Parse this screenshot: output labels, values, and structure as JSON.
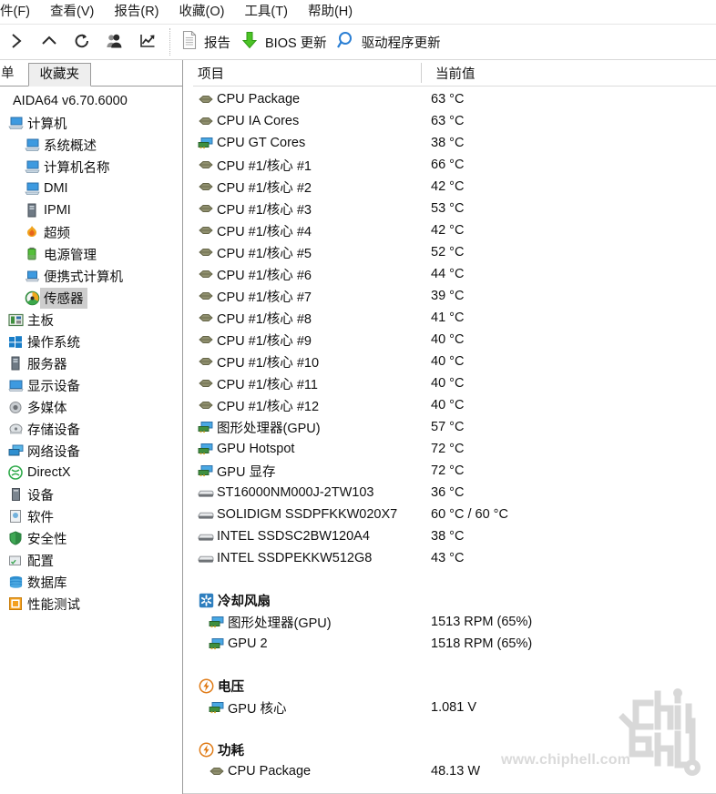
{
  "menu": {
    "items": [
      {
        "label": "件(F)",
        "name": "menu-file"
      },
      {
        "label": "查看(V)",
        "name": "menu-view"
      },
      {
        "label": "报告(R)",
        "name": "menu-report"
      },
      {
        "label": "收藏(O)",
        "name": "menu-favorites"
      },
      {
        "label": "工具(T)",
        "name": "menu-tools"
      },
      {
        "label": "帮助(H)",
        "name": "menu-help"
      }
    ]
  },
  "toolbar": {
    "icons": [
      {
        "name": "forward-icon"
      },
      {
        "name": "up-icon"
      },
      {
        "name": "refresh-icon"
      },
      {
        "name": "users-icon"
      },
      {
        "name": "chart-icon"
      }
    ],
    "report_label": "报告",
    "bios_update_label": "BIOS 更新",
    "driver_update_label": "驱动程序更新"
  },
  "tabs": {
    "menu_tab": "单",
    "favorites_tab": "收藏夹"
  },
  "tree": {
    "root": "AIDA64 v6.70.6000",
    "items": [
      {
        "label": "计算机",
        "icon": "computer-icon",
        "level": 1
      },
      {
        "label": "系统概述",
        "icon": "computer-icon",
        "level": 2
      },
      {
        "label": "计算机名称",
        "icon": "computer-icon",
        "level": 2
      },
      {
        "label": "DMI",
        "icon": "computer-icon",
        "level": 2
      },
      {
        "label": "IPMI",
        "icon": "server-icon",
        "level": 2
      },
      {
        "label": "超频",
        "icon": "flame-icon",
        "level": 2
      },
      {
        "label": "电源管理",
        "icon": "battery-icon",
        "level": 2
      },
      {
        "label": "便携式计算机",
        "icon": "laptop-icon",
        "level": 2
      },
      {
        "label": "传感器",
        "icon": "sensor-icon",
        "level": 2,
        "selected": true
      },
      {
        "label": "主板",
        "icon": "motherboard-icon",
        "level": 1
      },
      {
        "label": "操作系统",
        "icon": "windows-icon",
        "level": 1
      },
      {
        "label": "服务器",
        "icon": "server-icon",
        "level": 1
      },
      {
        "label": "显示设备",
        "icon": "display-icon",
        "level": 1
      },
      {
        "label": "多媒体",
        "icon": "speaker-icon",
        "level": 1
      },
      {
        "label": "存储设备",
        "icon": "storage-icon",
        "level": 1
      },
      {
        "label": "网络设备",
        "icon": "network-icon",
        "level": 1
      },
      {
        "label": "DirectX",
        "icon": "directx-icon",
        "level": 1
      },
      {
        "label": "设备",
        "icon": "device-icon",
        "level": 1
      },
      {
        "label": "软件",
        "icon": "software-icon",
        "level": 1
      },
      {
        "label": "安全性",
        "icon": "shield-icon",
        "level": 1
      },
      {
        "label": "配置",
        "icon": "config-icon",
        "level": 1
      },
      {
        "label": "数据库",
        "icon": "database-icon",
        "level": 1
      },
      {
        "label": "性能测试",
        "icon": "benchmark-icon",
        "level": 1
      }
    ]
  },
  "columns": {
    "item": "项目",
    "current_value": "当前值"
  },
  "sensors": {
    "temperatures": [
      {
        "label": "CPU Package",
        "value": "63 °C",
        "icon": "chip-icon"
      },
      {
        "label": "CPU IA Cores",
        "value": "63 °C",
        "icon": "chip-icon"
      },
      {
        "label": "CPU GT Cores",
        "value": "38 °C",
        "icon": "gpu-icon"
      },
      {
        "label": "CPU #1/核心 #1",
        "value": "66 °C",
        "icon": "chip-icon"
      },
      {
        "label": "CPU #1/核心 #2",
        "value": "42 °C",
        "icon": "chip-icon"
      },
      {
        "label": "CPU #1/核心 #3",
        "value": "53 °C",
        "icon": "chip-icon"
      },
      {
        "label": "CPU #1/核心 #4",
        "value": "42 °C",
        "icon": "chip-icon"
      },
      {
        "label": "CPU #1/核心 #5",
        "value": "52 °C",
        "icon": "chip-icon"
      },
      {
        "label": "CPU #1/核心 #6",
        "value": "44 °C",
        "icon": "chip-icon"
      },
      {
        "label": "CPU #1/核心 #7",
        "value": "39 °C",
        "icon": "chip-icon"
      },
      {
        "label": "CPU #1/核心 #8",
        "value": "41 °C",
        "icon": "chip-icon"
      },
      {
        "label": "CPU #1/核心 #9",
        "value": "40 °C",
        "icon": "chip-icon"
      },
      {
        "label": "CPU #1/核心 #10",
        "value": "40 °C",
        "icon": "chip-icon"
      },
      {
        "label": "CPU #1/核心 #11",
        "value": "40 °C",
        "icon": "chip-icon"
      },
      {
        "label": "CPU #1/核心 #12",
        "value": "40 °C",
        "icon": "chip-icon"
      },
      {
        "label": "图形处理器(GPU)",
        "value": "57 °C",
        "icon": "gpu-icon"
      },
      {
        "label": "GPU Hotspot",
        "value": "72 °C",
        "icon": "gpu-icon"
      },
      {
        "label": "GPU 显存",
        "value": "72 °C",
        "icon": "gpu-icon"
      },
      {
        "label": "ST16000NM000J-2TW103",
        "value": "36 °C",
        "icon": "hdd-icon"
      },
      {
        "label": "SOLIDIGM SSDPFKKW020X7",
        "value": "60 °C / 60 °C",
        "icon": "hdd-icon"
      },
      {
        "label": "INTEL SSDSC2BW120A4",
        "value": "38 °C",
        "icon": "hdd-icon"
      },
      {
        "label": "INTEL SSDPEKKW512G8",
        "value": "43 °C",
        "icon": "hdd-icon"
      }
    ],
    "fans": {
      "title": "冷却风扇",
      "icon": "fan-icon",
      "rows": [
        {
          "label": "图形处理器(GPU)",
          "value": "1513 RPM  (65%)",
          "icon": "gpu-icon"
        },
        {
          "label": "GPU 2",
          "value": "1518 RPM  (65%)",
          "icon": "gpu-icon"
        }
      ]
    },
    "voltages": {
      "title": "电压",
      "icon": "bolt-icon",
      "rows": [
        {
          "label": "GPU 核心",
          "value": "1.081 V",
          "icon": "gpu-icon"
        }
      ]
    },
    "power": {
      "title": "功耗",
      "icon": "bolt-icon",
      "rows": [
        {
          "label": "CPU Package",
          "value": "48.13 W",
          "icon": "chip-icon"
        }
      ]
    }
  },
  "watermark": {
    "url_text": "www.chiphell.com",
    "logo_line1": "chip",
    "logo_line2": "hell"
  },
  "colors": {
    "accent_blue": "#2f7fd1",
    "green": "#3aad2f",
    "orange": "#e08a1e",
    "selection_gray": "#cdcdcd"
  }
}
